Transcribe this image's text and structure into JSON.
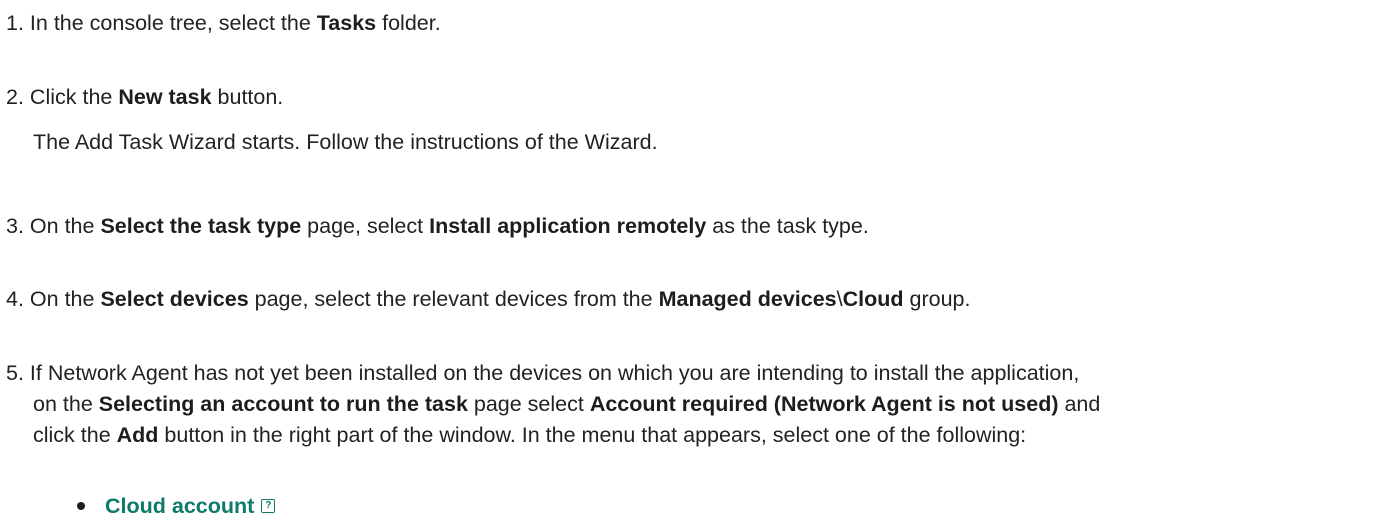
{
  "steps": [
    {
      "num": "1.",
      "t1": "In the console tree, select the ",
      "b1": "Tasks",
      "t2": " folder."
    },
    {
      "num": "2.",
      "t1": "Click the ",
      "b1": "New task",
      "t2": " button."
    },
    {
      "sub": "The Add Task Wizard starts. Follow the instructions of the Wizard."
    },
    {
      "num": "3.",
      "t1": "On the ",
      "b1": "Select the task type",
      "t2": " page, select ",
      "b2": "Install application remotely",
      "t3": " as the task type."
    },
    {
      "num": "4.",
      "t1": "On the ",
      "b1": "Select devices",
      "t2": " page, select the relevant devices from the ",
      "b2": "Managed devices",
      "t3": "\\",
      "b3": "Cloud",
      "t4": " group."
    },
    {
      "num": "5.",
      "t1": "If Network Agent has not yet been installed on the devices on which you are intending to install the application,"
    },
    {
      "t1": "on the ",
      "b1": "Selecting an account to run the task",
      "t2": " page select ",
      "b2": "Account required (Network Agent is not used)",
      "t3": " and"
    },
    {
      "t1": "click the ",
      "b1": "Add",
      "t2": " button in the right part of the window. In the menu that appears, select one of the following:"
    }
  ],
  "bullet": {
    "link": "Cloud account",
    "icon": "help-icon",
    "icon_glyph": "?"
  },
  "colors": {
    "link": "#0e7a69",
    "text": "#222222"
  }
}
